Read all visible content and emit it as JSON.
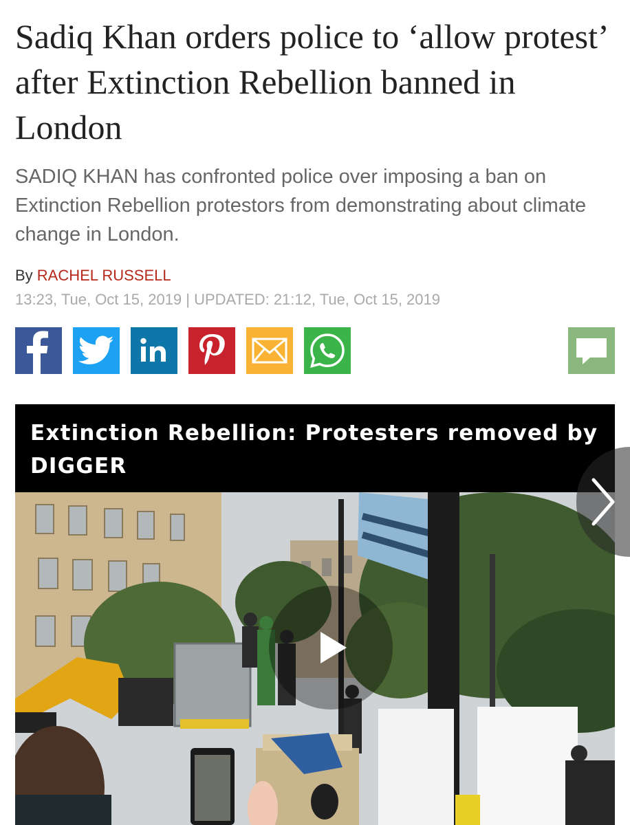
{
  "article": {
    "headline": "Sadiq Khan orders police to ‘allow protest’ after Extinction Rebellion banned in London",
    "standfirst": "SADIQ KHAN has confronted police over imposing a ban on Extinction Rebellion protestors from demonstrating about climate change in London.",
    "byline_prefix": "By ",
    "author": "RACHEL RUSSELL",
    "dateline": "13:23, Tue, Oct 15, 2019 | UPDATED: 21:12, Tue, Oct 15, 2019"
  },
  "share": {
    "buttons": [
      {
        "icon": "facebook-icon",
        "color": "#3b5998"
      },
      {
        "icon": "twitter-icon",
        "color": "#1da1f2"
      },
      {
        "icon": "linkedin-icon",
        "color": "#0e76a8"
      },
      {
        "icon": "pinterest-icon",
        "color": "#c8232c"
      },
      {
        "icon": "email-icon",
        "color": "#f9b233"
      },
      {
        "icon": "whatsapp-icon",
        "color": "#3bb44a"
      }
    ],
    "comments": {
      "icon": "comment-bubble-icon",
      "color": "#8ab77d"
    }
  },
  "video": {
    "title": "Extinction Rebellion: Protesters removed by DIGGER",
    "play_icon": "play-icon",
    "next_icon": "chevron-right-icon"
  },
  "colors": {
    "headline": "#222222",
    "standfirst": "#666666",
    "author": "#b5281a",
    "dateline": "#a9a9a9"
  }
}
